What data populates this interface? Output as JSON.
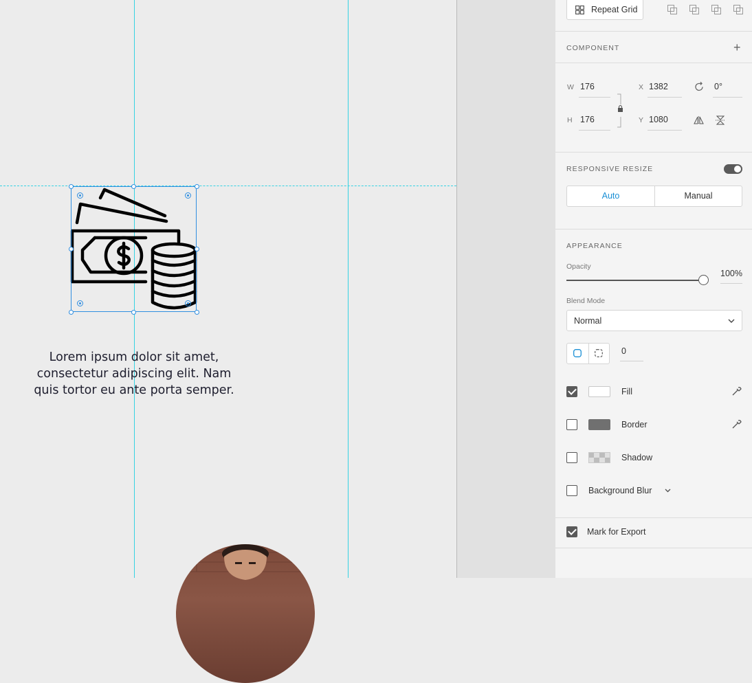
{
  "canvas": {
    "lorem_line1": "Lorem ipsum dolor sit amet,",
    "lorem_line2": "consectetur adipiscing elit. Nam",
    "lorem_line3": "quis tortor eu ante porta semper.",
    "selected_icon": "money-coins-icon"
  },
  "panel": {
    "repeat_grid_label": "Repeat Grid",
    "component_label": "COMPONENT",
    "w_label": "W",
    "w_value": "176",
    "h_label": "H",
    "h_value": "176",
    "x_label": "X",
    "x_value": "1382",
    "y_label": "Y",
    "y_value": "1080",
    "rotation_value": "0°",
    "responsive_resize_label": "RESPONSIVE RESIZE",
    "auto_label": "Auto",
    "manual_label": "Manual",
    "appearance_label": "APPEARANCE",
    "opacity_label": "Opacity",
    "opacity_value": "100%",
    "blend_mode_label": "Blend Mode",
    "blend_mode_value": "Normal",
    "corner_radius_value": "0",
    "fill_label": "Fill",
    "border_label": "Border",
    "shadow_label": "Shadow",
    "background_blur_label": "Background Blur",
    "mark_export_label": "Mark for Export"
  },
  "colors": {
    "accent": "#2f8ee0",
    "guide": "#34d2e3",
    "fill_swatch": "#ffffff",
    "border_swatch": "#707070"
  }
}
